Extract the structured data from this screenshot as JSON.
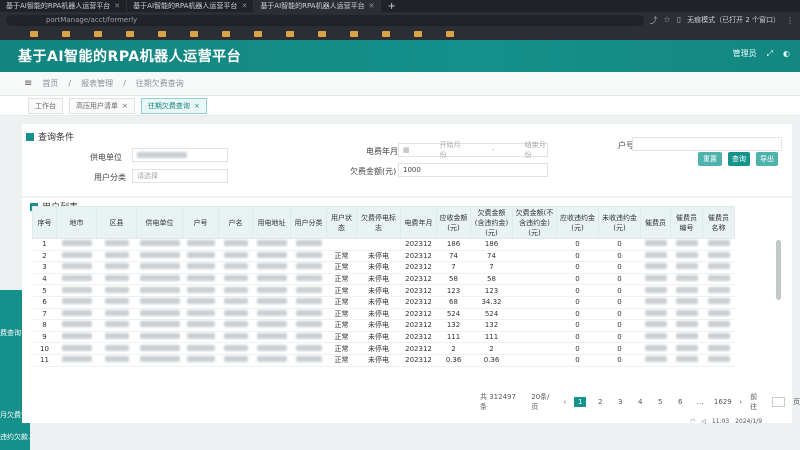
{
  "browser": {
    "tabs": [
      {
        "label": "基于AI智能的RPA机器人运营平台"
      },
      {
        "label": "基于AI智能的RPA机器人运营平台"
      },
      {
        "label": "基于AI智能的RPA机器人运营平台"
      }
    ],
    "address": "portManage/acct/formerly",
    "incognito": "无痕模式（已打开 2 个窗口）"
  },
  "app": {
    "title": "基于AI智能的RPA机器人运营平台",
    "user_role": "管理员"
  },
  "breadcrumb": [
    "首页",
    "报表管理",
    "往期欠费查询"
  ],
  "page_tabs": [
    {
      "label": "工作台"
    },
    {
      "label": "高压用户清单"
    },
    {
      "label": "往期欠费查询"
    }
  ],
  "query": {
    "title": "查询条件",
    "supply_unit_label": "供电单位",
    "user_category_label": "用户分类",
    "user_category_placeholder": "请选择",
    "month_label": "电费年月",
    "start_month_placeholder": "开始月份",
    "end_month_placeholder": "结束月份",
    "arrears_label": "欠费金额(元)",
    "arrears_value": "1000",
    "account_label": "户号",
    "reset": "重置",
    "search": "查询",
    "export": "导出"
  },
  "list": {
    "title": "用户列表",
    "columns": [
      "序号",
      "地市",
      "区县",
      "供电单位",
      "户号",
      "户名",
      "用电地址",
      "用户分类",
      "用户状态",
      "欠费停电标志",
      "电费年月",
      "应收金额(元)",
      "欠费金额(含违约金)(元)",
      "欠费金额(不含违约金)(元)",
      "应收违约金(元)",
      "未收违约金(元)",
      "催费员",
      "催费员编号",
      "催费员名称"
    ],
    "rows": [
      {
        "no": "1",
        "status": "",
        "flag": "",
        "month": "202312",
        "due": "186",
        "arrears": "186",
        "p1": "0",
        "p2": "0"
      },
      {
        "no": "2",
        "status": "正常",
        "flag": "未停电",
        "month": "202312",
        "due": "74",
        "arrears": "74",
        "p1": "0",
        "p2": "0"
      },
      {
        "no": "3",
        "status": "正常",
        "flag": "未停电",
        "month": "202312",
        "due": "7",
        "arrears": "7",
        "p1": "0",
        "p2": "0"
      },
      {
        "no": "4",
        "status": "正常",
        "flag": "未停电",
        "month": "202312",
        "due": "58",
        "arrears": "58",
        "p1": "0",
        "p2": "0"
      },
      {
        "no": "5",
        "status": "正常",
        "flag": "未停电",
        "month": "202312",
        "due": "123",
        "arrears": "123",
        "p1": "0",
        "p2": "0"
      },
      {
        "no": "6",
        "status": "正常",
        "flag": "未停电",
        "month": "202312",
        "due": "68",
        "arrears": "34.32",
        "p1": "0",
        "p2": "0"
      },
      {
        "no": "7",
        "status": "正常",
        "flag": "未停电",
        "month": "202312",
        "due": "524",
        "arrears": "524",
        "p1": "0",
        "p2": "0"
      },
      {
        "no": "8",
        "status": "正常",
        "flag": "未停电",
        "month": "202312",
        "due": "132",
        "arrears": "132",
        "p1": "0",
        "p2": "0"
      },
      {
        "no": "9",
        "status": "正常",
        "flag": "未停电",
        "month": "202312",
        "due": "111",
        "arrears": "111",
        "p1": "0",
        "p2": "0"
      },
      {
        "no": "10",
        "status": "正常",
        "flag": "未停电",
        "month": "202312",
        "due": "2",
        "arrears": "2",
        "p1": "0",
        "p2": "0"
      },
      {
        "no": "11",
        "status": "正常",
        "flag": "未停电",
        "month": "202312",
        "due": "0.36",
        "arrears": "0.36",
        "p1": "0",
        "p2": "0"
      }
    ],
    "total": "共 312497 条",
    "page_size": "20条/页",
    "pages": [
      "1",
      "2",
      "3",
      "4",
      "5",
      "6",
      "...",
      "1629"
    ],
    "goto_label": "前往",
    "goto_suffix": "页"
  },
  "leftnav": [
    "费查询",
    "月欠费查询",
    "违约欠款..."
  ],
  "taskbar": {
    "time": "11:03",
    "date": "2024/1/9"
  }
}
